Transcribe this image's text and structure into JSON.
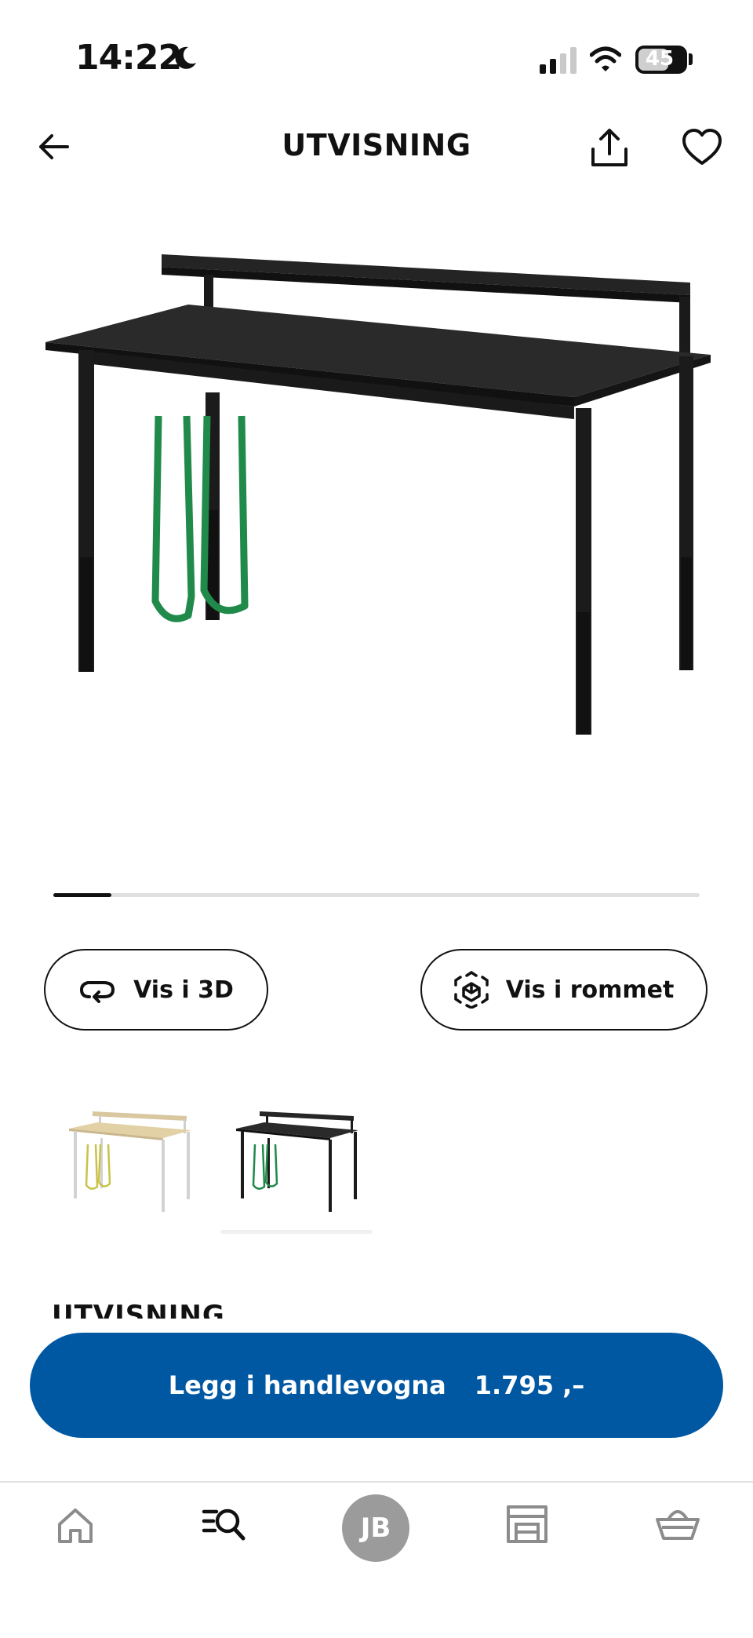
{
  "status_bar": {
    "time": "14:22",
    "battery": "45"
  },
  "header": {
    "title": "UTVISNING"
  },
  "carousel": {
    "progress": 0.09
  },
  "actions": {
    "view_3d": "Vis i 3D",
    "view_in_room": "Vis i rommet"
  },
  "section": {
    "heading": "UTVISNING"
  },
  "cart": {
    "label": "Legg i handlevogna",
    "price": "1.795 ,–"
  },
  "nav": {
    "avatar_initials": "JB"
  },
  "colors": {
    "primary_blue": "#0058a3",
    "strap_green": "#1f8a4a",
    "desk_black": "#1c1c1c"
  },
  "icons": [
    "back-arrow-icon",
    "share-icon",
    "heart-icon",
    "rotate-3d-icon",
    "ar-cube-icon",
    "home-icon",
    "search-list-icon",
    "store-icon",
    "basket-icon"
  ]
}
